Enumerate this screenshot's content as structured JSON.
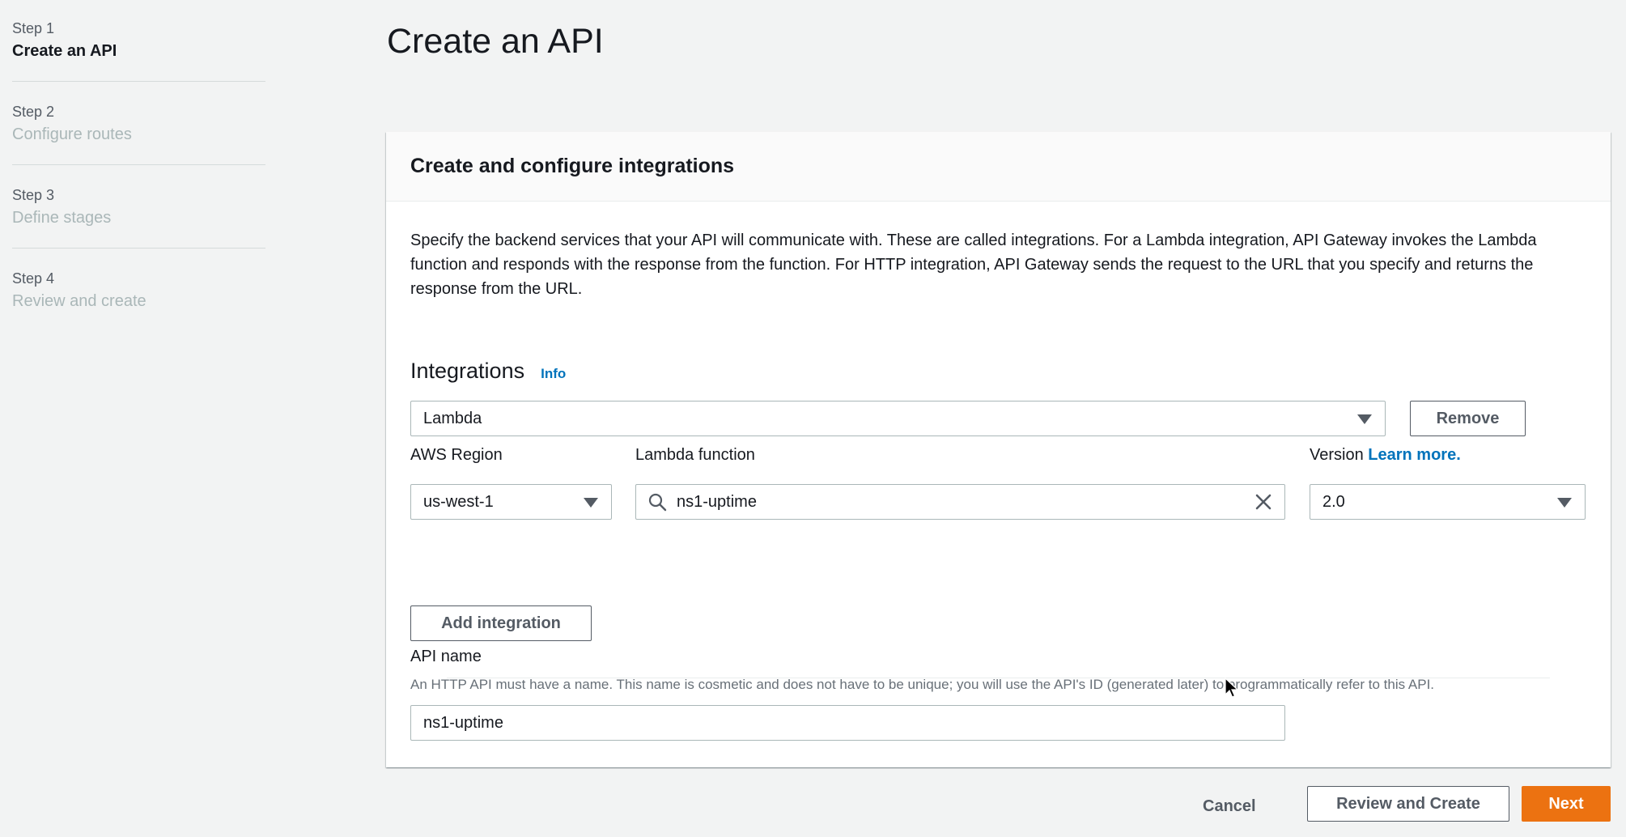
{
  "steps": [
    {
      "num": "Step 1",
      "title": "Create an API"
    },
    {
      "num": "Step 2",
      "title": "Configure routes"
    },
    {
      "num": "Step 3",
      "title": "Define stages"
    },
    {
      "num": "Step 4",
      "title": "Review and create"
    }
  ],
  "page": {
    "title": "Create an API"
  },
  "card": {
    "title": "Create and configure integrations",
    "description": "Specify the backend services that your API will communicate with. These are called integrations. For a Lambda integration, API Gateway invokes the Lambda function and responds with the response from the function. For HTTP integration, API Gateway sends the request to the URL that you specify and returns the response from the URL."
  },
  "integrations": {
    "heading": "Integrations",
    "info_label": "Info",
    "type_value": "Lambda",
    "remove_label": "Remove",
    "region_label": "AWS Region",
    "region_value": "us-west-1",
    "function_label": "Lambda function",
    "function_value": "ns1-uptime",
    "version_label": "Version",
    "version_link": "Learn more.",
    "version_value": "2.0",
    "add_label": "Add integration"
  },
  "api_name": {
    "label": "API name",
    "description": "An HTTP API must have a name. This name is cosmetic and does not have to be unique; you will use the API's ID (generated later) to programmatically refer to this API.",
    "value": "ns1-uptime"
  },
  "footer": {
    "cancel_label": "Cancel",
    "review_label": "Review and Create",
    "next_label": "Next"
  },
  "colors": {
    "primary": "#ec7211",
    "link": "#0073bb",
    "background": "#f2f3f3"
  }
}
